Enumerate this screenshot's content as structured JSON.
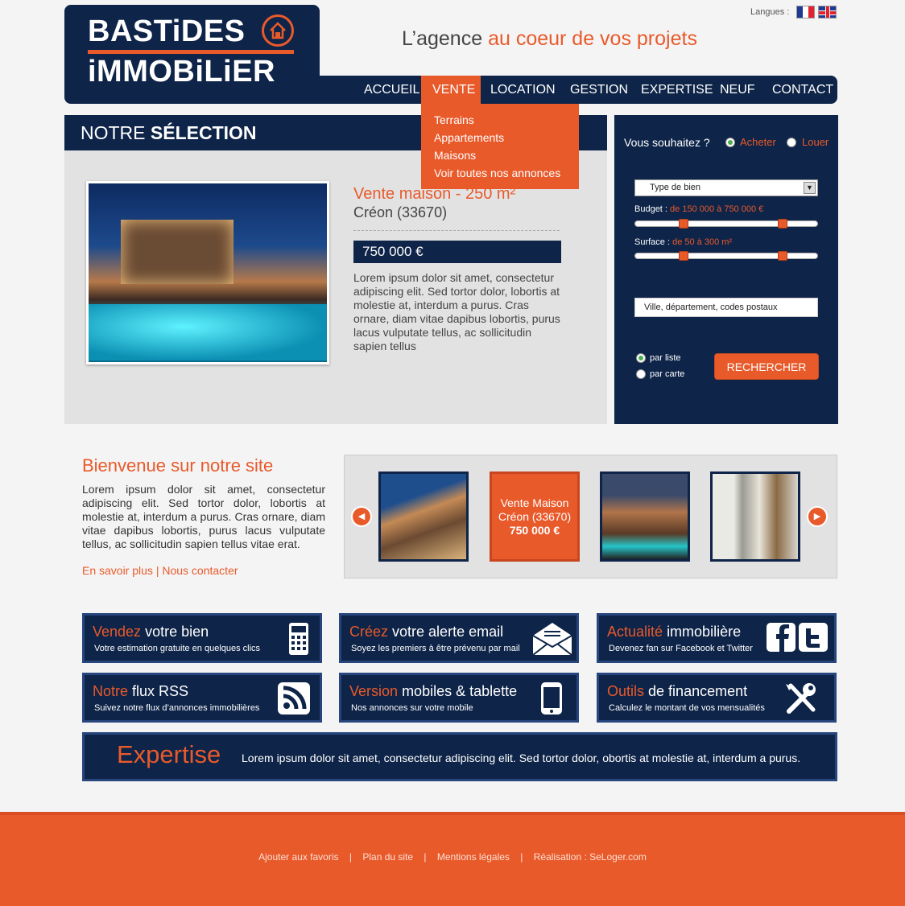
{
  "header": {
    "logo_line1": "BASTiDES",
    "logo_line2": "iMMOBiLiER",
    "tagline_part1": "L’agence",
    "tagline_part2": "au coeur de vos projets",
    "languages_label": "Langues :",
    "flags": [
      "french-flag-icon",
      "uk-flag-icon"
    ]
  },
  "nav": {
    "items": [
      "ACCUEIL",
      "VENTE",
      "LOCATION",
      "GESTION",
      "EXPERTISE",
      "NEUF",
      "CONTACT"
    ],
    "active": "VENTE",
    "dropdown": [
      "Terrains",
      "Appartements",
      "Maisons",
      "Voir toutes nos annonces"
    ]
  },
  "selection": {
    "heading_part1": "NOTRE",
    "heading_part2": "SÉLECTION",
    "title": "Vente maison - 250 m²",
    "location": "Créon (33670)",
    "price": "750 000 €",
    "description": "Lorem ipsum dolor sit amet, consectetur adipiscing elit. Sed tortor dolor, lobortis at molestie at, interdum a purus. Cras ornare, diam vitae dapibus lobortis, purus lacus vulputate tellus, ac sollicitudin sapien tellus"
  },
  "search": {
    "question": "Vous souhaitez ?",
    "option_buy": "Acheter",
    "option_rent": "Louer",
    "selected_option": "Acheter",
    "type_placeholder": "Type de bien",
    "budget_label": "Budget :",
    "budget_value": "de 150 000 à 750 000 €",
    "surface_label": "Surface :",
    "surface_value": "de 50 à 300 m²",
    "city_placeholder": "Ville, département, codes postaux",
    "view_list": "par liste",
    "view_map": "par carte",
    "selected_view": "par liste",
    "button": "RECHERCHER",
    "budget_range_fraction": [
      0.25,
      0.82
    ],
    "surface_range_fraction": [
      0.25,
      0.82
    ]
  },
  "welcome": {
    "title_part1": "Bienvenue",
    "title_part2": "sur notre site",
    "text": "Lorem ipsum dolor sit amet, consectetur adipiscing elit. Sed tortor dolor, lobortis at molestie at, interdum a purus. Cras ornare, diam vitae dapibus lobortis, purus lacus vulputate tellus, ac sollicitudin sapien tellus vitae erat.",
    "link1": "En savoir plus",
    "separator": "|",
    "link2": "Nous contacter"
  },
  "carousel": {
    "featured_line1": "Vente Maison",
    "featured_line2": "Créon (33670)",
    "featured_price": "750 000 €",
    "prev_icon": "arrow-left-icon",
    "next_icon": "arrow-right-icon"
  },
  "tiles": [
    {
      "accent": "Vendez",
      "rest": "votre bien",
      "sub": "Votre estimation gratuite en quelques clics",
      "icon": "calculator-icon"
    },
    {
      "accent": "Créez",
      "rest": "votre alerte email",
      "sub": "Soyez les premiers à être prévenu par mail",
      "icon": "envelope-icon"
    },
    {
      "accent": "Actualité",
      "rest": "immobilière",
      "sub": "Devenez fan sur Facebook et Twitter",
      "icon": "facebook-twitter-icon"
    },
    {
      "accent": "Notre",
      "rest": "flux RSS",
      "sub": "Suivez notre flux d’annonces immobilières",
      "icon": "rss-icon"
    },
    {
      "accent": "Version",
      "rest": "mobiles & tablette",
      "sub": "Nos annonces sur votre mobile",
      "icon": "mobile-icon"
    },
    {
      "accent": "Outils",
      "rest": "de financement",
      "sub": "Calculez le montant de vos mensualités",
      "icon": "tools-icon"
    }
  ],
  "expertise": {
    "title": "Expertise",
    "text": "Lorem ipsum dolor sit amet, consectetur adipiscing elit. Sed tortor dolor, obortis at molestie at, interdum a purus."
  },
  "footer": {
    "links": [
      "Ajouter aux favoris",
      "Plan du site",
      "Mentions légales",
      "Réalisation : SeLoger.com"
    ],
    "separator": "|"
  },
  "colors": {
    "navy": "#0e2448",
    "orange": "#e95a2b",
    "grey": "#e2e2e2"
  }
}
